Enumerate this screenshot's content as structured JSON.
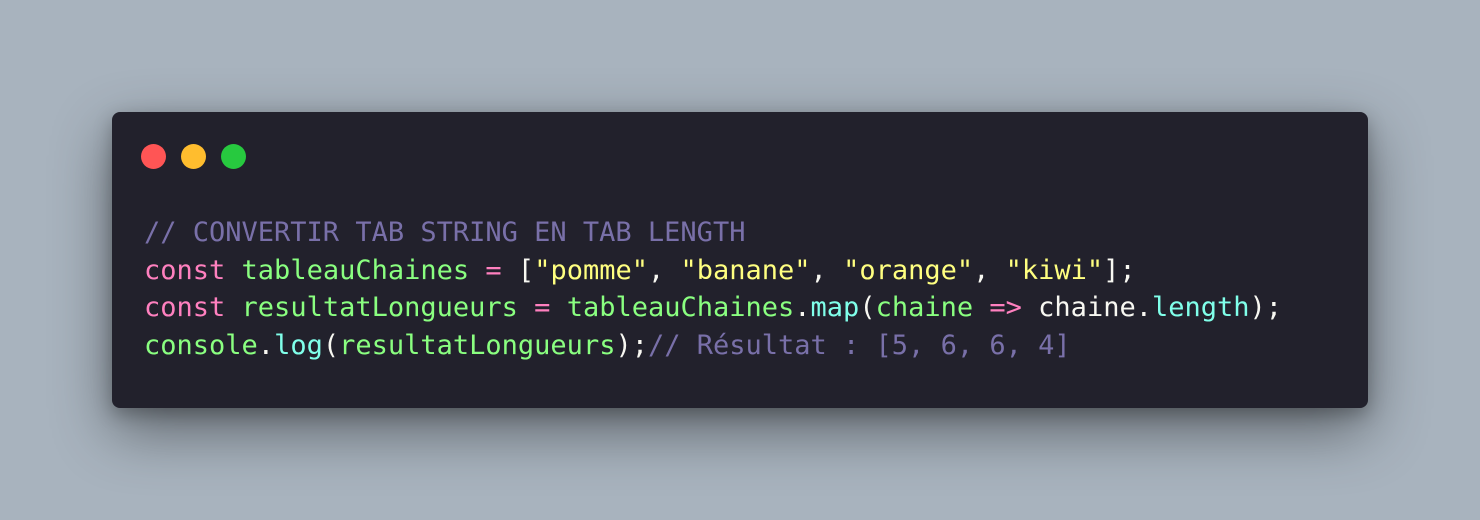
{
  "window": {
    "traffic_lights": [
      {
        "name": "close",
        "color": "#ff5555"
      },
      {
        "name": "minimize",
        "color": "#ffbd2e"
      },
      {
        "name": "maximize",
        "color": "#27c93f"
      }
    ]
  },
  "colors": {
    "background": "#a8b3be",
    "window": "#22212c",
    "comment": "#7970a9",
    "keyword": "#ff80bf",
    "variable": "#8aff80",
    "string": "#ffff80",
    "method": "#80ffea",
    "plain": "#f8f8f2"
  },
  "code": {
    "lines": [
      [
        {
          "t": "// CONVERTIR TAB STRING EN TAB LENGTH",
          "k": "comment"
        }
      ],
      [
        {
          "t": "const",
          "k": "keyword"
        },
        {
          "t": " ",
          "k": "plain"
        },
        {
          "t": "tableauChaines",
          "k": "var"
        },
        {
          "t": " ",
          "k": "plain"
        },
        {
          "t": "=",
          "k": "op"
        },
        {
          "t": " ",
          "k": "plain"
        },
        {
          "t": "[",
          "k": "punc"
        },
        {
          "t": "\"pomme\"",
          "k": "string"
        },
        {
          "t": ", ",
          "k": "punc"
        },
        {
          "t": "\"banane\"",
          "k": "string"
        },
        {
          "t": ", ",
          "k": "punc"
        },
        {
          "t": "\"orange\"",
          "k": "string"
        },
        {
          "t": ", ",
          "k": "punc"
        },
        {
          "t": "\"kiwi\"",
          "k": "string"
        },
        {
          "t": "];",
          "k": "punc"
        }
      ],
      [
        {
          "t": "const",
          "k": "keyword"
        },
        {
          "t": " ",
          "k": "plain"
        },
        {
          "t": "resultatLongueurs",
          "k": "var"
        },
        {
          "t": " ",
          "k": "plain"
        },
        {
          "t": "=",
          "k": "op"
        },
        {
          "t": " ",
          "k": "plain"
        },
        {
          "t": "tableauChaines",
          "k": "var"
        },
        {
          "t": ".",
          "k": "punc"
        },
        {
          "t": "map",
          "k": "method"
        },
        {
          "t": "(",
          "k": "punc"
        },
        {
          "t": "chaine",
          "k": "param"
        },
        {
          "t": " ",
          "k": "plain"
        },
        {
          "t": "=>",
          "k": "op"
        },
        {
          "t": " ",
          "k": "plain"
        },
        {
          "t": "chaine",
          "k": "plain"
        },
        {
          "t": ".",
          "k": "punc"
        },
        {
          "t": "length",
          "k": "method"
        },
        {
          "t": ");",
          "k": "punc"
        }
      ],
      [
        {
          "t": "console",
          "k": "var"
        },
        {
          "t": ".",
          "k": "punc"
        },
        {
          "t": "log",
          "k": "method"
        },
        {
          "t": "(",
          "k": "punc"
        },
        {
          "t": "resultatLongueurs",
          "k": "var"
        },
        {
          "t": ");",
          "k": "punc"
        },
        {
          "t": "// Résultat : [5, 6, 6, 4]",
          "k": "comment"
        }
      ]
    ]
  }
}
